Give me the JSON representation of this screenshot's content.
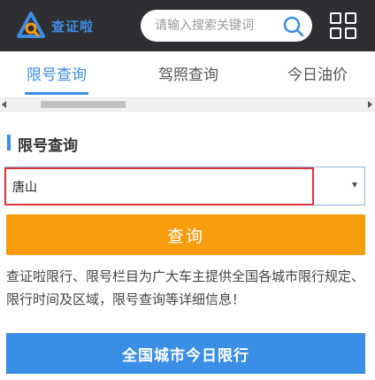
{
  "header": {
    "logo_text": "查证啦",
    "search": {
      "placeholder": "请输入搜索关键词",
      "value": ""
    }
  },
  "tabs": [
    {
      "label": "限号查询",
      "active": true
    },
    {
      "label": "驾照查询",
      "active": false
    },
    {
      "label": "今日油价",
      "active": false
    }
  ],
  "section": {
    "title": "限号查询"
  },
  "city_select": {
    "selected": "唐山"
  },
  "query_button": {
    "label": "查询"
  },
  "description": "查证啦限行、限号栏目为广大车主提供全国各城市限行规定、限行时间及区域，限号查询等详细信息！",
  "cta_button": {
    "label": "全国城市今日限行"
  },
  "colors": {
    "header_bg": "#2e2e33",
    "accent_blue": "#3a8ee6",
    "query_orange": "#f79d0c",
    "highlight_red": "#e0363b"
  },
  "icons": [
    "logo-icon",
    "search-icon",
    "grid-menu-icon",
    "scroll-left-arrow-icon",
    "scroll-right-arrow-icon",
    "dropdown-arrow-icon"
  ]
}
